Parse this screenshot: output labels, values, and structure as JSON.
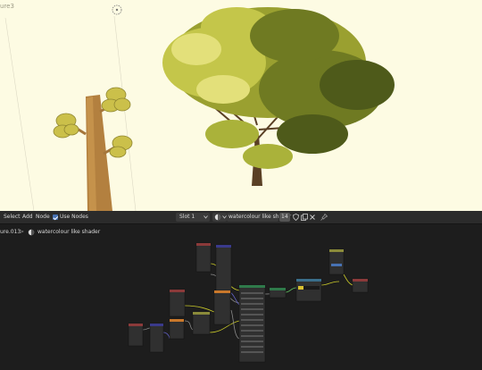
{
  "viewport": {
    "corner_label": "ure3"
  },
  "header": {
    "menu": [
      "Select",
      "Add",
      "Node"
    ],
    "use_nodes_label": "Use Nodes",
    "use_nodes_checked": true,
    "slot": "Slot 1",
    "material_name": "watercolour like shader",
    "user_count": "14"
  },
  "breadcrumb": {
    "object": "ure.013",
    "separator": ">",
    "material": "watercolour like shader"
  },
  "colors": {
    "background": "#fdfbe3",
    "editor_bg": "#1d1d1d",
    "accent": "#4772b3"
  },
  "icons": [
    "gizmo-icon",
    "material-sphere-icon",
    "chevron-down-icon",
    "shield-icon",
    "duplicate-icon",
    "close-icon",
    "pin-icon"
  ]
}
